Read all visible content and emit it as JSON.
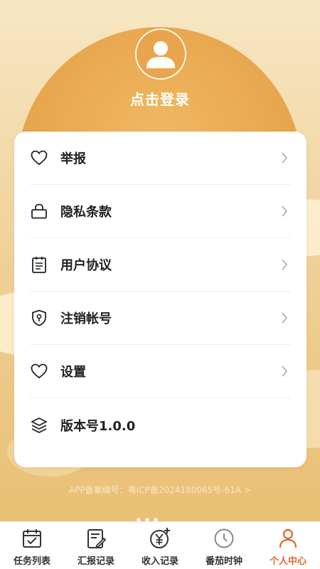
{
  "header": {
    "login_text": "点击登录"
  },
  "menu": {
    "items": [
      {
        "label": "举报",
        "icon": "heart-icon"
      },
      {
        "label": "隐私条款",
        "icon": "lock-icon"
      },
      {
        "label": "用户协议",
        "icon": "clipboard-icon"
      },
      {
        "label": "注销帐号",
        "icon": "shield-icon"
      },
      {
        "label": "设置",
        "icon": "heart-icon"
      },
      {
        "label": "版本号1.0.0",
        "icon": "layers-icon"
      }
    ]
  },
  "footer": {
    "icp": "APP备案编号：粤ICP备2024180065号-61A >"
  },
  "tabbar": {
    "tabs": [
      {
        "label": "任务列表",
        "icon": "calendar-check-icon"
      },
      {
        "label": "汇报记录",
        "icon": "report-edit-icon"
      },
      {
        "label": "收入记录",
        "icon": "yen-plus-icon"
      },
      {
        "label": "番茄时钟",
        "icon": "clock-icon"
      },
      {
        "label": "个人中心",
        "icon": "person-icon"
      }
    ],
    "active_color": "#e8642c"
  }
}
